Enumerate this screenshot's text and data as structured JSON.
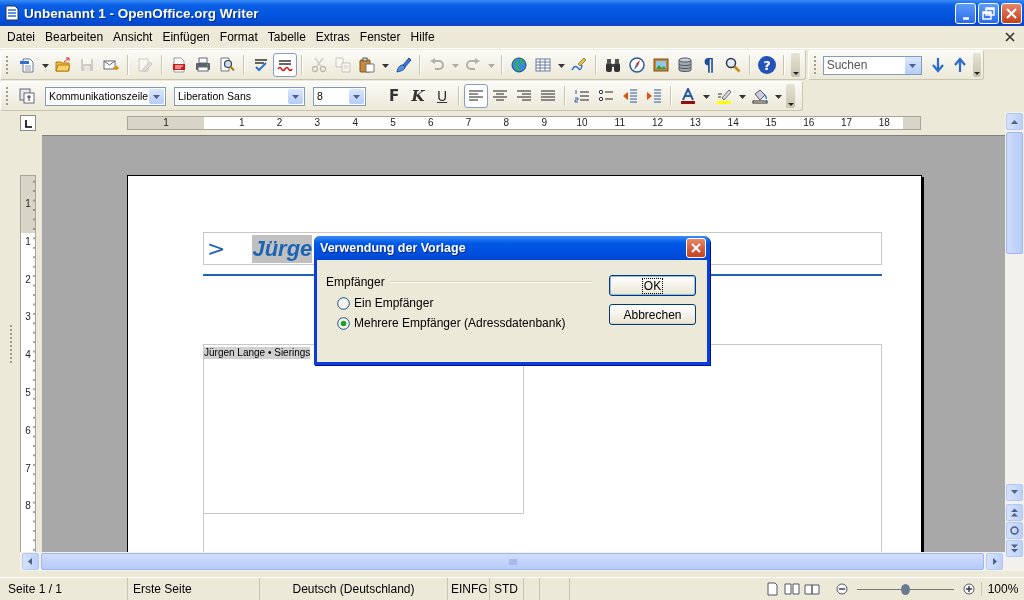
{
  "window": {
    "title": "Unbenannt 1 - OpenOffice.org Writer"
  },
  "menu": [
    "Datei",
    "Bearbeiten",
    "Ansicht",
    "Einfügen",
    "Format",
    "Tabelle",
    "Extras",
    "Fenster",
    "Hilfe"
  ],
  "standard_toolbar": [
    [
      {
        "kind": "new",
        "disabled": false,
        "pressed": false,
        "dropdown": true
      },
      {
        "kind": "open",
        "disabled": false,
        "pressed": false,
        "dropdown": false
      },
      {
        "kind": "save",
        "disabled": true,
        "pressed": false,
        "dropdown": false
      },
      {
        "kind": "mail",
        "disabled": false,
        "pressed": false,
        "dropdown": false
      }
    ],
    [
      {
        "kind": "edit",
        "disabled": true,
        "pressed": false,
        "dropdown": false
      }
    ],
    [
      {
        "kind": "pdf",
        "disabled": false,
        "pressed": false,
        "dropdown": false
      },
      {
        "kind": "print",
        "disabled": false,
        "pressed": false,
        "dropdown": false
      },
      {
        "kind": "preview",
        "disabled": false,
        "pressed": false,
        "dropdown": false
      }
    ],
    [
      {
        "kind": "spell",
        "disabled": false,
        "pressed": false,
        "dropdown": false
      },
      {
        "kind": "autospell",
        "disabled": false,
        "pressed": true,
        "dropdown": false
      }
    ],
    [
      {
        "kind": "cut",
        "disabled": true,
        "pressed": false,
        "dropdown": false
      },
      {
        "kind": "copy",
        "disabled": true,
        "pressed": false,
        "dropdown": false
      },
      {
        "kind": "paste",
        "disabled": false,
        "pressed": false,
        "dropdown": true
      },
      {
        "kind": "brush",
        "disabled": false,
        "pressed": false,
        "dropdown": false
      }
    ],
    [
      {
        "kind": "undo",
        "disabled": true,
        "pressed": false,
        "dropdown": true
      },
      {
        "kind": "redo",
        "disabled": true,
        "pressed": false,
        "dropdown": true
      }
    ],
    [
      {
        "kind": "globe",
        "disabled": false,
        "pressed": false,
        "dropdown": false
      },
      {
        "kind": "table",
        "disabled": false,
        "pressed": false,
        "dropdown": true
      },
      {
        "kind": "draw",
        "disabled": false,
        "pressed": false,
        "dropdown": false
      }
    ],
    [
      {
        "kind": "find",
        "disabled": false,
        "pressed": false,
        "dropdown": false
      },
      {
        "kind": "compass",
        "disabled": false,
        "pressed": false,
        "dropdown": false
      },
      {
        "kind": "gallery",
        "disabled": false,
        "pressed": false,
        "dropdown": false
      },
      {
        "kind": "database",
        "disabled": false,
        "pressed": false,
        "dropdown": false
      },
      {
        "kind": "pilcrow",
        "label": "¶",
        "disabled": false,
        "pressed": false,
        "dropdown": false
      },
      {
        "kind": "zoom",
        "disabled": false,
        "pressed": false,
        "dropdown": false
      }
    ],
    [
      {
        "kind": "help",
        "label": "?",
        "disabled": false,
        "pressed": false,
        "dropdown": false
      }
    ]
  ],
  "search_toolbar": {
    "placeholder": "Suchen"
  },
  "formatting_toolbar": {
    "paragraph_style": "Kommunikationszeile",
    "font_name": "Liberation Sans",
    "font_size": "8",
    "groups": [
      [
        {
          "kind": "bold",
          "label": "F",
          "disabled": false,
          "pressed": false,
          "dropdown": false
        },
        {
          "kind": "italic",
          "label": "K",
          "disabled": false,
          "pressed": false,
          "dropdown": false
        },
        {
          "kind": "underline",
          "label": "U",
          "disabled": false,
          "pressed": false,
          "dropdown": false
        }
      ],
      [
        {
          "kind": "align_left",
          "disabled": false,
          "pressed": true,
          "dropdown": false
        },
        {
          "kind": "align_center",
          "disabled": false,
          "pressed": false,
          "dropdown": false
        },
        {
          "kind": "align_right",
          "disabled": false,
          "pressed": false,
          "dropdown": false
        },
        {
          "kind": "justify",
          "disabled": false,
          "pressed": false,
          "dropdown": false
        }
      ],
      [
        {
          "kind": "numbering",
          "disabled": false,
          "pressed": false,
          "dropdown": false
        },
        {
          "kind": "bullets",
          "disabled": false,
          "pressed": false,
          "dropdown": false
        },
        {
          "kind": "outdent",
          "disabled": false,
          "pressed": false,
          "dropdown": false
        },
        {
          "kind": "indent",
          "disabled": false,
          "pressed": false,
          "dropdown": false
        }
      ],
      [
        {
          "kind": "font_color",
          "disabled": false,
          "pressed": false,
          "dropdown": true
        },
        {
          "kind": "highlight",
          "disabled": false,
          "pressed": false,
          "dropdown": true
        },
        {
          "kind": "background",
          "disabled": false,
          "pressed": false,
          "dropdown": true
        }
      ]
    ]
  },
  "horizontal_ruler": [
    "1",
    "1",
    "2",
    "3",
    "4",
    "5",
    "6",
    "7",
    "8",
    "9",
    "10",
    "11",
    "12",
    "13",
    "14",
    "15",
    "16",
    "17",
    "18"
  ],
  "vertical_ruler": [
    "1",
    "1",
    "2",
    "3",
    "4",
    "5",
    "6",
    "7",
    "8"
  ],
  "document": {
    "header_marker": ">",
    "header_name": "Jürge",
    "sender_line": "Jürgen Lange • Sierings"
  },
  "dialog": {
    "title": "Verwendung der Vorlage",
    "group": "Empfänger",
    "options": [
      {
        "label": "Ein Empfänger",
        "selected": false
      },
      {
        "label": "Mehrere Empfänger (Adressdatenbank)",
        "selected": true
      }
    ],
    "buttons": [
      {
        "label": "OK",
        "default": true
      },
      {
        "label": "Abbrechen",
        "default": false
      }
    ]
  },
  "status_bar": {
    "page": "Seite 1 / 1",
    "page_style": "Erste Seite",
    "language": "Deutsch (Deutschland)",
    "insert_mode": "EINFG",
    "selection_mode": "STD",
    "zoom": {
      "level": 0.5,
      "reading": "100%"
    }
  }
}
